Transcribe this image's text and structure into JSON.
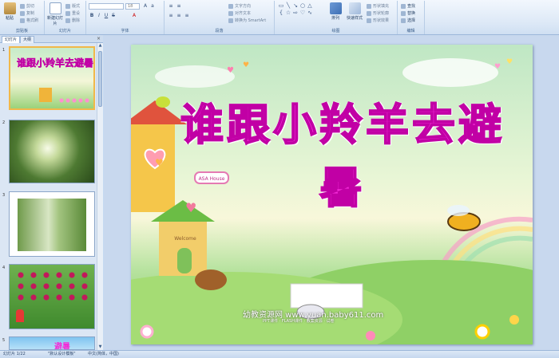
{
  "ribbon": {
    "clipboard": {
      "paste": "粘贴",
      "cut": "剪切",
      "copy": "复制",
      "format_painter": "格式刷",
      "label": "剪贴板"
    },
    "slides": {
      "new_slide": "新建幻灯片",
      "layout": "版式",
      "reset": "重设",
      "delete": "删除",
      "label": "幻灯片"
    },
    "font": {
      "font_name": "",
      "font_size": "18",
      "label": "字体"
    },
    "paragraph": {
      "text_direction": "文字方向",
      "align_text": "对齐文本",
      "smartart": "转换为 SmartArt",
      "label": "段落"
    },
    "drawing": {
      "arrange": "排列",
      "quick_styles": "快速样式",
      "shape_fill": "形状填充",
      "shape_outline": "形状轮廓",
      "shape_effects": "形状效果",
      "label": "绘图"
    },
    "editing": {
      "find": "查找",
      "replace": "替换",
      "select": "选择",
      "label": "编辑"
    }
  },
  "panel": {
    "tab_slides": "幻灯片",
    "tab_outline": "大纲",
    "close": "×",
    "thumbnails": [
      {
        "num": "1",
        "title": "谁跟小羚羊去避暑"
      },
      {
        "num": "2"
      },
      {
        "num": "3"
      },
      {
        "num": "4"
      },
      {
        "num": "5",
        "title": "避暑"
      }
    ]
  },
  "slide": {
    "title": "谁跟小羚羊去避暑",
    "sign": "ASA House",
    "door": "Welcome",
    "watermark": "幼教资源网 www.yuan.baby611.com",
    "watermark_sub": "PPT课件 · FLASH课件 · 教案资源 · 试卷"
  },
  "status": {
    "slide_pos": "幻灯片 1/22",
    "theme": "\"默认设计模板\"",
    "lang": "中文(简体，中国)"
  },
  "colors": {
    "title": "#f32ad7",
    "title_stroke": "#c100a5",
    "ribbon": "#dce8f6",
    "selected_thumb": "#f1b84a"
  }
}
